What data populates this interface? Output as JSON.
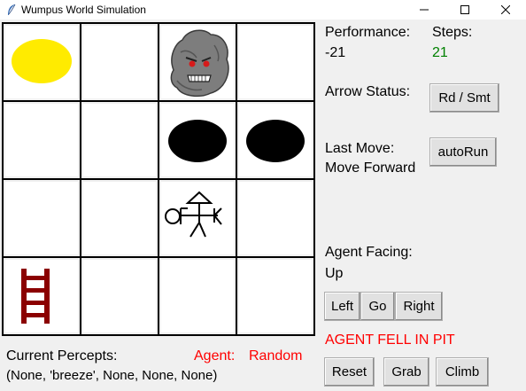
{
  "window": {
    "title": "Wumpus World Simulation"
  },
  "board": {
    "rows": 4,
    "cols": 4,
    "cells": [
      [
        "gold",
        "empty",
        "wumpus",
        "empty"
      ],
      [
        "empty",
        "empty",
        "pit",
        "pit"
      ],
      [
        "empty",
        "empty",
        "agent",
        "empty"
      ],
      [
        "ladder",
        "empty",
        "empty",
        "empty"
      ]
    ]
  },
  "performance": {
    "label": "Performance:",
    "value": "-21"
  },
  "steps": {
    "label": "Steps:",
    "value": "21"
  },
  "arrow": {
    "label": "Arrow Status:",
    "button": "Rd / Smt"
  },
  "last_move": {
    "label": "Last Move:",
    "value": "Move Forward",
    "button": "autoRun"
  },
  "facing": {
    "label": "Agent Facing:",
    "value": "Up"
  },
  "controls": {
    "left": "Left",
    "go": "Go",
    "right": "Right",
    "reset": "Reset",
    "grab": "Grab",
    "climb": "Climb"
  },
  "status_message": "AGENT FELL IN PIT",
  "percepts": {
    "label": "Current Percepts:",
    "value": "(None, 'breeze', None, None, None)"
  },
  "agent_mode": {
    "label": "Agent:",
    "value": "Random"
  },
  "colors": {
    "steps_value": "#008000",
    "alert": "#ff0000",
    "gold": "#ffeb00",
    "ladder": "#8b0000"
  }
}
